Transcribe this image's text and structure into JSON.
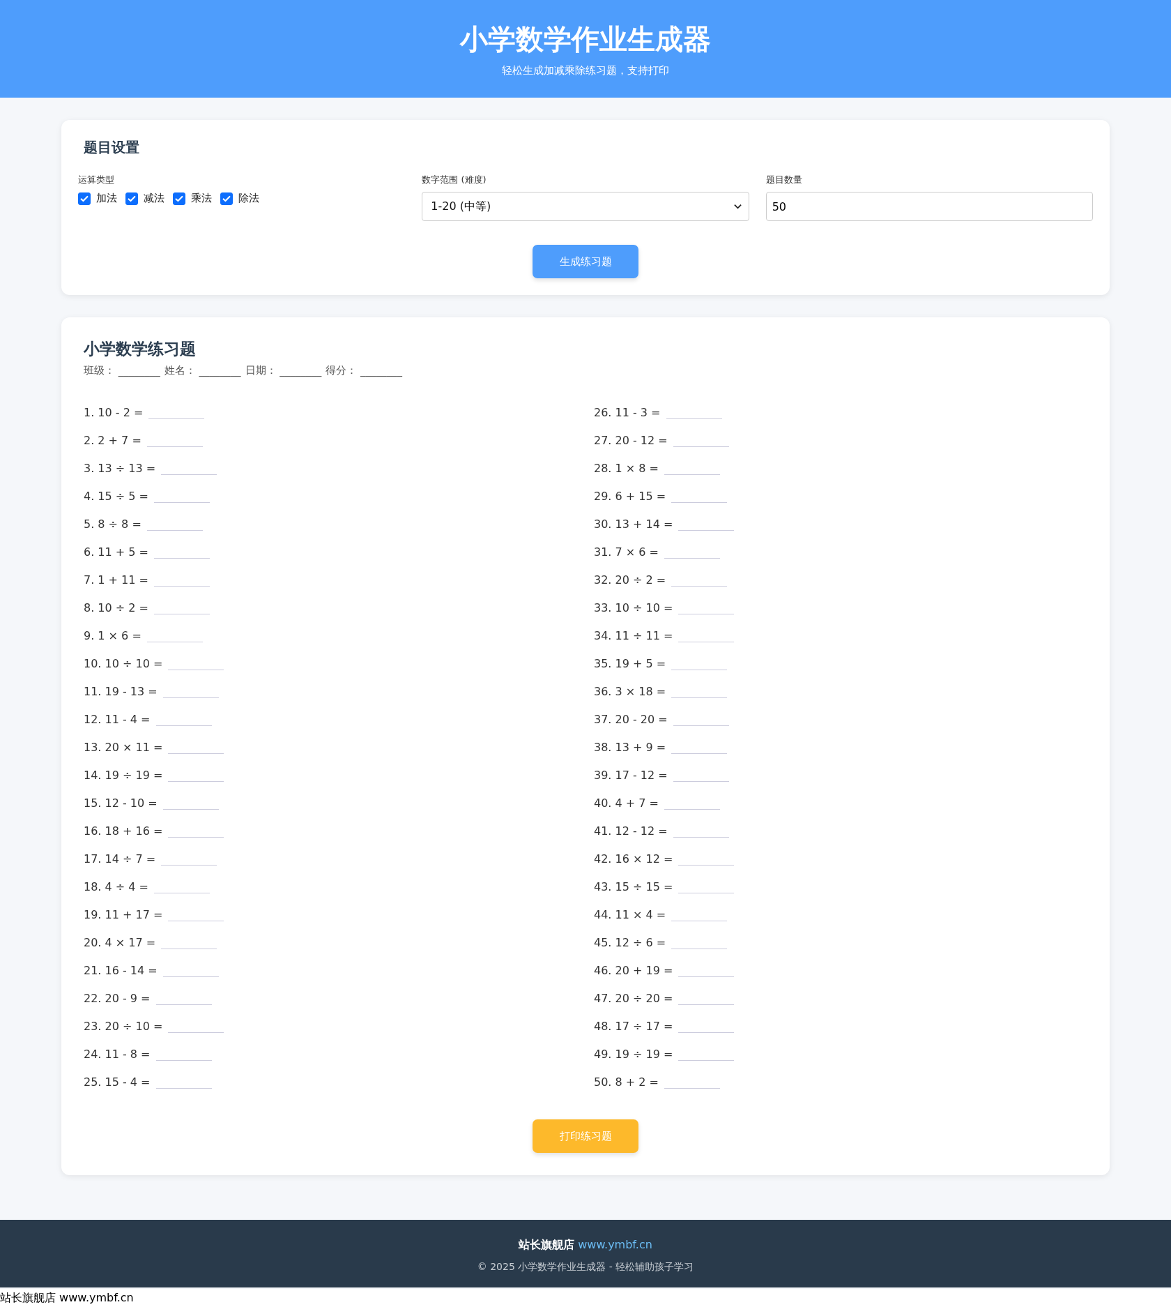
{
  "header": {
    "title": "小学数学作业生成器",
    "subtitle": "轻松生成加减乘除练习题，支持打印"
  },
  "settings": {
    "title": "题目设置",
    "operations": {
      "label": "运算类型",
      "options": [
        {
          "label": "加法",
          "checked": true
        },
        {
          "label": "减法",
          "checked": true
        },
        {
          "label": "乘法",
          "checked": true
        },
        {
          "label": "除法",
          "checked": true
        }
      ]
    },
    "range": {
      "label": "数字范围 (难度)",
      "value": "1-20 (中等)"
    },
    "count": {
      "label": "题目数量",
      "value": "50"
    },
    "generate_button": "生成练习题"
  },
  "worksheet": {
    "title": "小学数学练习题",
    "info": [
      {
        "label": "班级：",
        "blank": "________"
      },
      {
        "label": "姓名：",
        "blank": "________"
      },
      {
        "label": "日期：",
        "blank": "________"
      },
      {
        "label": "得分：",
        "blank": "________"
      }
    ],
    "problems": [
      "1. 10 - 2 =",
      "2. 2 + 7 =",
      "3. 13 ÷ 13 =",
      "4. 15 ÷ 5 =",
      "5. 8 ÷ 8 =",
      "6. 11 + 5 =",
      "7. 1 + 11 =",
      "8. 10 ÷ 2 =",
      "9. 1 × 6 =",
      "10. 10 ÷ 10 =",
      "11. 19 - 13 =",
      "12. 11 - 4 =",
      "13. 20 × 11 =",
      "14. 19 ÷ 19 =",
      "15. 12 - 10 =",
      "16. 18 + 16 =",
      "17. 14 ÷ 7 =",
      "18. 4 ÷ 4 =",
      "19. 11 + 17 =",
      "20. 4 × 17 =",
      "21. 16 - 14 =",
      "22. 20 - 9 =",
      "23. 20 ÷ 10 =",
      "24. 11 - 8 =",
      "25. 15 - 4 =",
      "26. 11 - 3 =",
      "27. 20 - 12 =",
      "28. 1 × 8 =",
      "29. 6 + 15 =",
      "30. 13 + 14 =",
      "31. 7 × 6 =",
      "32. 20 ÷ 2 =",
      "33. 10 ÷ 10 =",
      "34. 11 ÷ 11 =",
      "35. 19 + 5 =",
      "36. 3 × 18 =",
      "37. 20 - 20 =",
      "38. 13 + 9 =",
      "39. 17 - 12 =",
      "40. 4 + 7 =",
      "41. 12 - 12 =",
      "42. 16 × 12 =",
      "43. 15 ÷ 15 =",
      "44. 11 × 4 =",
      "45. 12 ÷ 6 =",
      "46. 20 + 19 =",
      "47. 20 ÷ 20 =",
      "48. 17 ÷ 17 =",
      "49. 19 ÷ 19 =",
      "50. 8 + 2 ="
    ],
    "print_button": "打印练习题"
  },
  "footer": {
    "store": "站长旗舰店",
    "link": "www.ymbf.cn",
    "copyright": "© 2025 小学数学作业生成器 - 轻松辅助孩子学习"
  },
  "bottom_note": "站长旗舰店 www.ymbf.cn"
}
